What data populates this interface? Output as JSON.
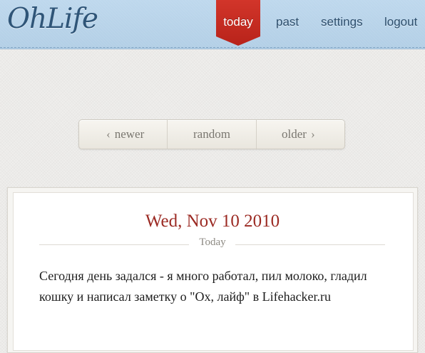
{
  "header": {
    "logo": "OhLife",
    "nav": {
      "today": "today",
      "past": "past",
      "settings": "settings",
      "logout": "logout"
    }
  },
  "pager": {
    "newer": "newer",
    "random": "random",
    "older": "older"
  },
  "entry": {
    "date": "Wed, Nov 10 2010",
    "label": "Today",
    "text": "Сегодня день задался - я много работал, пил молоко, гладил кошку и написал заметку о \"Ох, лайф\" в Lifehacker.ru"
  },
  "colors": {
    "header_bg": "#b9d4ea",
    "active_tab": "#c62a1f",
    "date": "#9b2a23"
  }
}
